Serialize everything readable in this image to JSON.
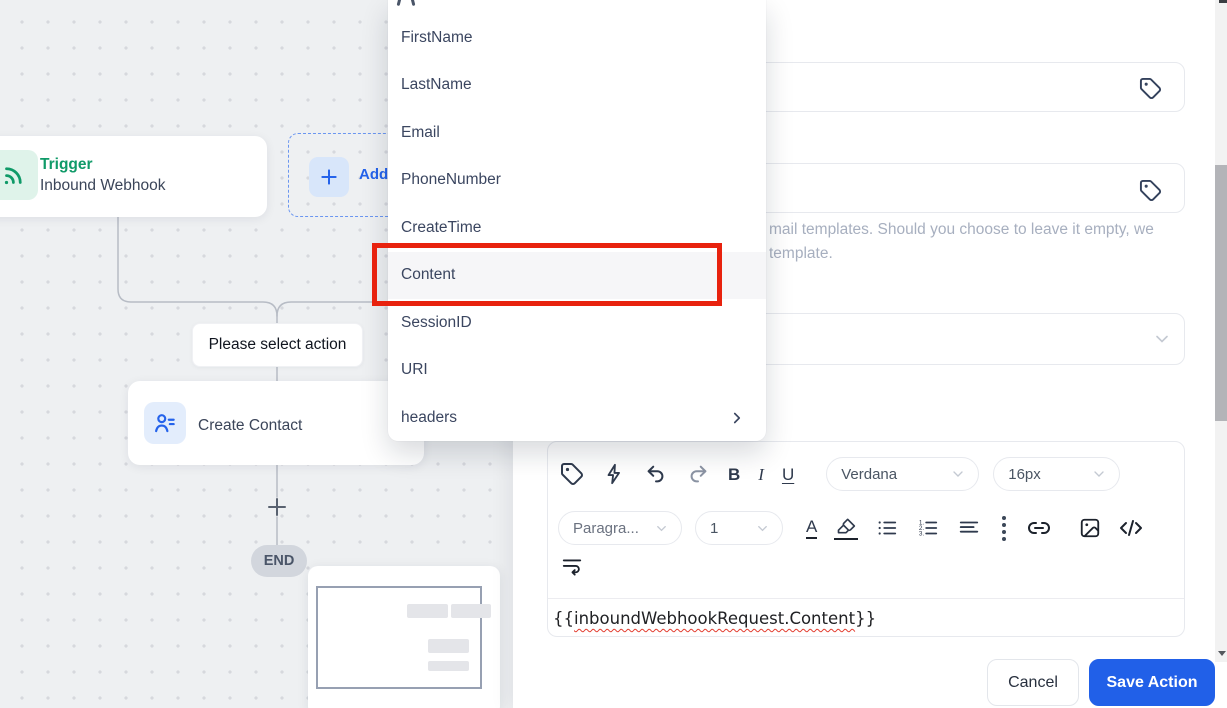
{
  "canvas": {
    "trigger": {
      "title": "Trigger",
      "subtitle": "Inbound Webhook"
    },
    "add_step": {
      "label": "Add"
    },
    "prompt_label": "Please select action",
    "action_node": {
      "label": "Create Contact"
    },
    "end_label": "END"
  },
  "dropdown": {
    "items": [
      {
        "label": "FirstName"
      },
      {
        "label": "LastName"
      },
      {
        "label": "Email"
      },
      {
        "label": "PhoneNumber"
      },
      {
        "label": "CreateTime"
      },
      {
        "label": "Content"
      },
      {
        "label": "SessionID"
      },
      {
        "label": "URI"
      },
      {
        "label": "headers"
      }
    ],
    "highlighted_item": "Content"
  },
  "panel": {
    "help_line1": "mail templates. Should you choose to leave it empty, we",
    "help_line2": "template.",
    "toolbar": {
      "bold": "B",
      "italic": "I",
      "underline": "U",
      "font_color": "A",
      "font_family": "Verdana",
      "font_size": "16px",
      "paragraph": "Paragra...",
      "line_height": "1"
    },
    "editor_content": {
      "open": "{{",
      "variable": "inboundWebhookRequest.Content",
      "close": "}}"
    },
    "footer": {
      "cancel": "Cancel",
      "save": "Save Action"
    }
  },
  "colors": {
    "accent_blue": "#2160e8",
    "trigger_green": "#0f9a68",
    "annotation_red": "#e8220e",
    "menu_highlight": "#f6f6f8",
    "canvas_bg": "#eef0f2",
    "end_pill": "#d2d6dd"
  }
}
